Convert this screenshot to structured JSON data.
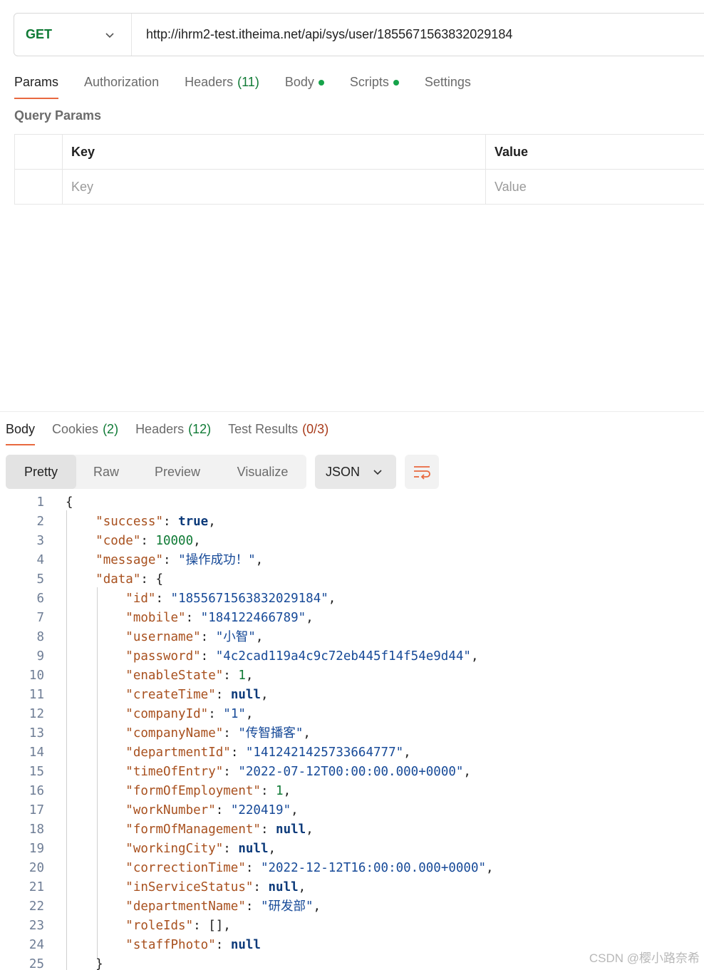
{
  "request": {
    "method": "GET",
    "url": "http://ihrm2-test.itheima.net/api/sys/user/1855671563832029184"
  },
  "request_tabs": [
    {
      "label": "Params",
      "count": ""
    },
    {
      "label": "Authorization",
      "count": ""
    },
    {
      "label": "Headers",
      "count": "(11)"
    },
    {
      "label": "Body",
      "count": ""
    },
    {
      "label": "Scripts",
      "count": ""
    },
    {
      "label": "Settings",
      "count": ""
    }
  ],
  "query_params": {
    "title": "Query Params",
    "header_key": "Key",
    "header_value": "Value",
    "placeholder_key": "Key",
    "placeholder_value": "Value"
  },
  "response_tabs": [
    {
      "label": "Body",
      "count": ""
    },
    {
      "label": "Cookies",
      "count": "(2)"
    },
    {
      "label": "Headers",
      "count": "(12)"
    },
    {
      "label": "Test Results",
      "count": "(0/3)"
    }
  ],
  "view_modes": [
    "Pretty",
    "Raw",
    "Preview",
    "Visualize"
  ],
  "format": "JSON",
  "code_lines": [
    {
      "n": "1",
      "text": "{"
    },
    {
      "n": "2",
      "text": "    \"success\": true,"
    },
    {
      "n": "3",
      "text": "    \"code\": 10000,"
    },
    {
      "n": "4",
      "text": "    \"message\": \"操作成功！\","
    },
    {
      "n": "5",
      "text": "    \"data\": {"
    },
    {
      "n": "6",
      "text": "        \"id\": \"1855671563832029184\","
    },
    {
      "n": "7",
      "text": "        \"mobile\": \"184122466789\","
    },
    {
      "n": "8",
      "text": "        \"username\": \"小智\","
    },
    {
      "n": "9",
      "text": "        \"password\": \"4c2cad119a4c9c72eb445f14f54e9d44\","
    },
    {
      "n": "10",
      "text": "        \"enableState\": 1,"
    },
    {
      "n": "11",
      "text": "        \"createTime\": null,"
    },
    {
      "n": "12",
      "text": "        \"companyId\": \"1\","
    },
    {
      "n": "13",
      "text": "        \"companyName\": \"传智播客\","
    },
    {
      "n": "14",
      "text": "        \"departmentId\": \"1412421425733664777\","
    },
    {
      "n": "15",
      "text": "        \"timeOfEntry\": \"2022-07-12T00:00:00.000+0000\","
    },
    {
      "n": "16",
      "text": "        \"formOfEmployment\": 1,"
    },
    {
      "n": "17",
      "text": "        \"workNumber\": \"220419\","
    },
    {
      "n": "18",
      "text": "        \"formOfManagement\": null,"
    },
    {
      "n": "19",
      "text": "        \"workingCity\": null,"
    },
    {
      "n": "20",
      "text": "        \"correctionTime\": \"2022-12-12T16:00:00.000+0000\","
    },
    {
      "n": "21",
      "text": "        \"inServiceStatus\": null,"
    },
    {
      "n": "22",
      "text": "        \"departmentName\": \"研发部\","
    },
    {
      "n": "23",
      "text": "        \"roleIds\": [],"
    },
    {
      "n": "24",
      "text": "        \"staffPhoto\": null"
    },
    {
      "n": "25",
      "text": "    }"
    }
  ],
  "colors": {
    "accent": "#e8693f",
    "method_green": "#0f7a35",
    "json_key": "#a8501e",
    "json_string": "#174a98",
    "json_number": "#0f7a35",
    "json_keyword": "#0c3a7a"
  },
  "watermark": "CSDN @樱小路奈希"
}
